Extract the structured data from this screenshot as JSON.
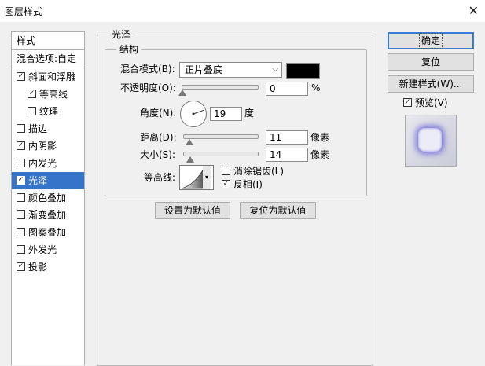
{
  "window": {
    "title": "图层样式",
    "close_glyph": "✕"
  },
  "styles_panel": {
    "header": "样式",
    "blend_options": "混合选项:自定",
    "items": [
      {
        "label": "斜面和浮雕",
        "checked": true,
        "sub": false,
        "selected": false
      },
      {
        "label": "等高线",
        "checked": true,
        "sub": true,
        "selected": false
      },
      {
        "label": "纹理",
        "checked": false,
        "sub": true,
        "selected": false
      },
      {
        "label": "描边",
        "checked": false,
        "sub": false,
        "selected": false
      },
      {
        "label": "内阴影",
        "checked": true,
        "sub": false,
        "selected": false
      },
      {
        "label": "内发光",
        "checked": false,
        "sub": false,
        "selected": false
      },
      {
        "label": "光泽",
        "checked": true,
        "sub": false,
        "selected": true
      },
      {
        "label": "颜色叠加",
        "checked": false,
        "sub": false,
        "selected": false
      },
      {
        "label": "渐变叠加",
        "checked": false,
        "sub": false,
        "selected": false
      },
      {
        "label": "图案叠加",
        "checked": false,
        "sub": false,
        "selected": false
      },
      {
        "label": "外发光",
        "checked": false,
        "sub": false,
        "selected": false
      },
      {
        "label": "投影",
        "checked": true,
        "sub": false,
        "selected": false
      }
    ]
  },
  "satin": {
    "section_title": "光泽",
    "structure_title": "结构",
    "blend_mode_label": "混合模式(B):",
    "blend_mode_value": "正片叠底",
    "blend_color": "#000000",
    "opacity_label": "不透明度(O):",
    "opacity_value": "0",
    "opacity_unit": "%",
    "angle_label": "角度(N):",
    "angle_value": "19",
    "angle_unit": "度",
    "distance_label": "距离(D):",
    "distance_value": "11",
    "distance_unit": "像素",
    "size_label": "大小(S):",
    "size_value": "14",
    "size_unit": "像素",
    "contour_label": "等高线:",
    "antialias_label": "消除锯齿(L)",
    "antialias_checked": false,
    "invert_label": "反相(I)",
    "invert_checked": true,
    "make_default": "设置为默认值",
    "reset_default": "复位为默认值"
  },
  "actions": {
    "ok": "确定",
    "reset": "复位",
    "new_style": "新建样式(W)...",
    "preview_label": "预览(V)",
    "preview_checked": true
  },
  "colors": {
    "selection": "#3574c8",
    "default_button_border": "#3a7bd5",
    "preview_glow": "#7b73d9"
  }
}
